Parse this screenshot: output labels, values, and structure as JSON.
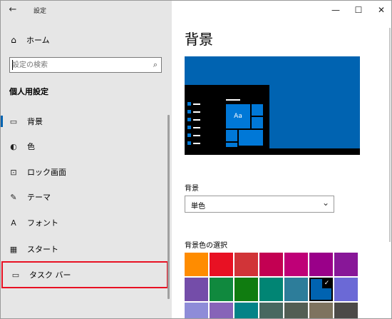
{
  "window": {
    "title": "設定"
  },
  "icons": {
    "back": "←",
    "home": "⌂",
    "search": "⌕",
    "background": "▭",
    "colors": "◐",
    "lock": "⊡",
    "themes": "✎",
    "fonts": "A",
    "start": "▦",
    "taskbar": "▭",
    "minimize": "—",
    "maximize": "☐",
    "close": "✕",
    "chevron": "⌄",
    "check": "✓"
  },
  "sidebar": {
    "home_label": "ホーム",
    "search_placeholder": "設定の検索",
    "section_title": "個人用設定",
    "items": [
      {
        "label": "背景",
        "icon": "background-icon",
        "selected": true
      },
      {
        "label": "色",
        "icon": "palette-icon"
      },
      {
        "label": "ロック画面",
        "icon": "lock-screen-icon"
      },
      {
        "label": "テーマ",
        "icon": "themes-icon"
      },
      {
        "label": "フォント",
        "icon": "font-icon"
      },
      {
        "label": "スタート",
        "icon": "start-icon"
      },
      {
        "label": "タスク バー",
        "icon": "taskbar-icon",
        "highlighted": true
      }
    ]
  },
  "main": {
    "title": "背景",
    "preview_tile_text": "Aa",
    "background_label": "背景",
    "background_value": "単色",
    "color_label": "背景色の選択",
    "swatches_row1": [
      "#ff8c00",
      "#e81123",
      "#d13438",
      "#c30052",
      "#bf0077",
      "#9a0089",
      "#881798"
    ],
    "swatches_row2": [
      "#744da9",
      "#10893e",
      "#107c10",
      "#018574",
      "#2d7d9a",
      "#0063b1",
      "#6b69d6"
    ],
    "swatches_row3": [
      "#8e8cd8",
      "#8764b8",
      "#038387",
      "#486860",
      "#525e54",
      "#7e735f",
      "#4c4a48"
    ],
    "selected_swatch": "#0063b1"
  }
}
